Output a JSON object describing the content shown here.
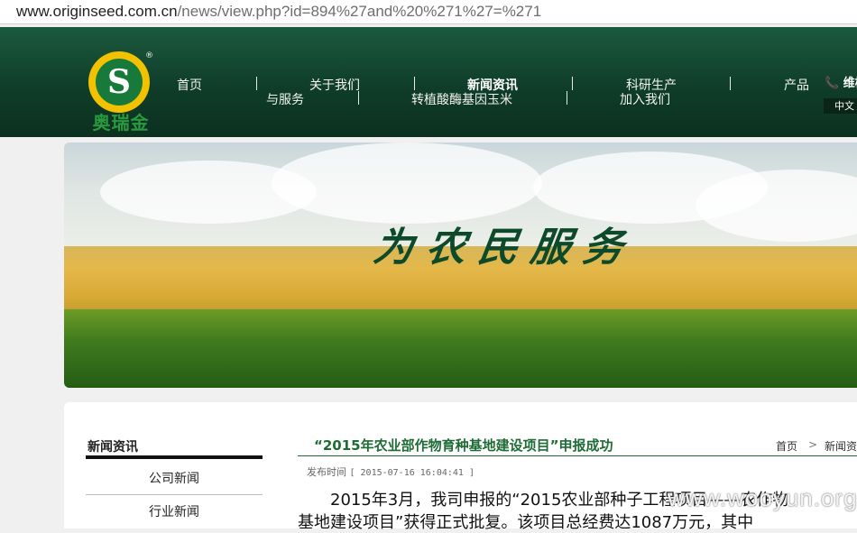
{
  "browser": {
    "url_host": "www.originseed.com.cn",
    "url_path": "/news/view.php?id=894%27and%20%271%27=%271"
  },
  "header": {
    "logo_letter": "S",
    "logo_reg": "®",
    "logo_text": "奥瑞金",
    "nav": [
      {
        "label": "首页"
      },
      {
        "label": "关于我们"
      },
      {
        "label": "与服务"
      },
      {
        "label": "新闻资讯"
      },
      {
        "label": "转植酸酶基因玉米"
      },
      {
        "label": "科研生产"
      },
      {
        "label": "加入我们"
      },
      {
        "label": "产品"
      }
    ],
    "phone_icon": "phone-icon",
    "phone_text": "📞 维模",
    "lang": "中文"
  },
  "banner": {
    "slogan": "为农民服务"
  },
  "sidebar": {
    "title": "新闻资讯",
    "items": [
      {
        "label": "公司新闻"
      },
      {
        "label": "行业新闻"
      }
    ]
  },
  "article": {
    "title": "“2015年农业部作物育种基地建设项目”申报成功",
    "breadcrumb_home": "首页",
    "breadcrumb_sep": ">",
    "breadcrumb_current": "新闻资",
    "meta_label": "发布时间",
    "meta_time": "[ 2015-07-16 16:04:41 ]",
    "body_line1": "2015年3月，我司申报的“2015农业部种子工程项目——农作物",
    "body_line2": "基地建设项目”获得正式批复。该项目总经费达1087万元，其中"
  },
  "watermark": "www.wooyun.org",
  "colors": {
    "header_green": "#0f3d2a",
    "accent_green": "#1f6b35",
    "logo_yellow": "#f2c200"
  }
}
